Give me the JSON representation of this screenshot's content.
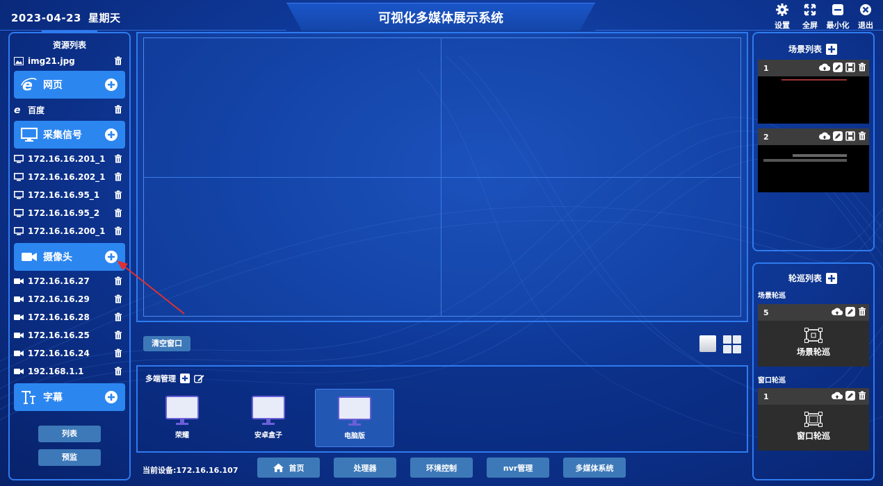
{
  "header": {
    "date": "2023-04-23",
    "weekday": "星期天",
    "title": "可视化多媒体展示系统",
    "buttons": [
      {
        "label": "设置",
        "icon": "gear-icon"
      },
      {
        "label": "全屏",
        "icon": "fullscreen-icon"
      },
      {
        "label": "最小化",
        "icon": "minimize-icon"
      },
      {
        "label": "退出",
        "icon": "close-icon"
      }
    ]
  },
  "resources": {
    "title": "资源列表",
    "top_item": "img21.jpg",
    "webpage": {
      "label": "网页",
      "items": [
        "百度"
      ]
    },
    "capture": {
      "label": "采集信号",
      "items": [
        "172.16.16.201_1",
        "172.16.16.202_1",
        "172.16.16.95_1",
        "172.16.16.95_2",
        "172.16.16.200_1"
      ]
    },
    "camera": {
      "label": "摄像头",
      "items": [
        "172.16.16.27",
        "172.16.16.29",
        "172.16.16.28",
        "172.16.16.25",
        "172.16.16.24",
        "192.168.1.1"
      ]
    },
    "subtitle": {
      "label": "字幕"
    },
    "list_btn": "列表",
    "preview_btn": "预监"
  },
  "screen": {
    "clear_btn": "清空窗口"
  },
  "multi": {
    "title": "多端管理",
    "devices": [
      {
        "label": "荣耀",
        "selected": false
      },
      {
        "label": "安卓盒子",
        "selected": false
      },
      {
        "label": "电脑版",
        "selected": true
      }
    ]
  },
  "footer": {
    "current_device": "当前设备:172.16.16.107",
    "nav": [
      "首页",
      "处理器",
      "环境控制",
      "nvr管理",
      "多媒体系统"
    ]
  },
  "scenes": {
    "title": "场景列表",
    "items": [
      {
        "num": "1"
      },
      {
        "num": "2"
      }
    ]
  },
  "tours": {
    "title": "轮巡列表",
    "scene_section": "场景轮巡",
    "window_section": "窗口轮巡",
    "scene_card": {
      "num": "5",
      "label": "场景轮巡"
    },
    "window_card": {
      "num": "1",
      "label": "窗口轮巡"
    }
  },
  "colors": {
    "bg": "#0f3a9a",
    "accent": "#2c86f0",
    "frame": "#2f7bf0",
    "button": "#3d79b8",
    "annotation": "#e03030"
  }
}
